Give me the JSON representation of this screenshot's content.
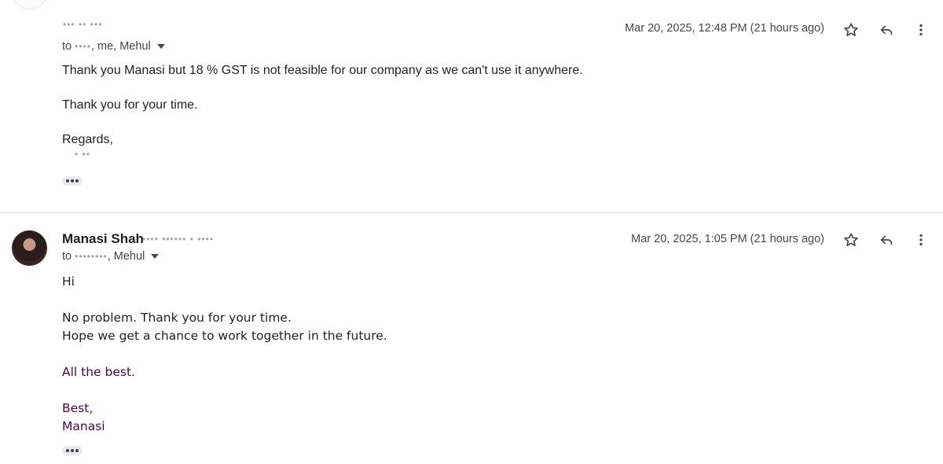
{
  "message1": {
    "sender_redacted": "••• •• •••",
    "to_prefix": "to",
    "to_redacted": "••••",
    "to_names": ", me, Mehul",
    "date": "Mar 20, 2025, 12:48 PM (21 hours ago)",
    "body": [
      "Thank you Manasi but 18 % GST is not feasible for our company as we can't use it anywhere.",
      "Thank you for your time.",
      "Regards,"
    ],
    "signature_redacted": "• ••"
  },
  "message2": {
    "sender": "Manasi Shah",
    "sender_email_redacted": "•••• •••••• • ••••",
    "to_prefix": "to",
    "to_redacted": "••••••••",
    "to_names": ", Mehul",
    "date": "Mar 20, 2025, 1:05 PM (21 hours ago)",
    "body": {
      "greeting": "Hi",
      "line1": "No problem. Thank you for your time.",
      "line2": "Hope we get a chance to work together in the future.",
      "closing": "All the best.",
      "signoff": "Best,",
      "name": "Manasi"
    }
  },
  "icons": {
    "star": "star-icon",
    "reply": "reply-icon",
    "more": "more-vert-icon",
    "expand": "show-trimmed-content-icon"
  },
  "colors": {
    "purple_text": "#500050",
    "secondary_text": "#444746"
  }
}
